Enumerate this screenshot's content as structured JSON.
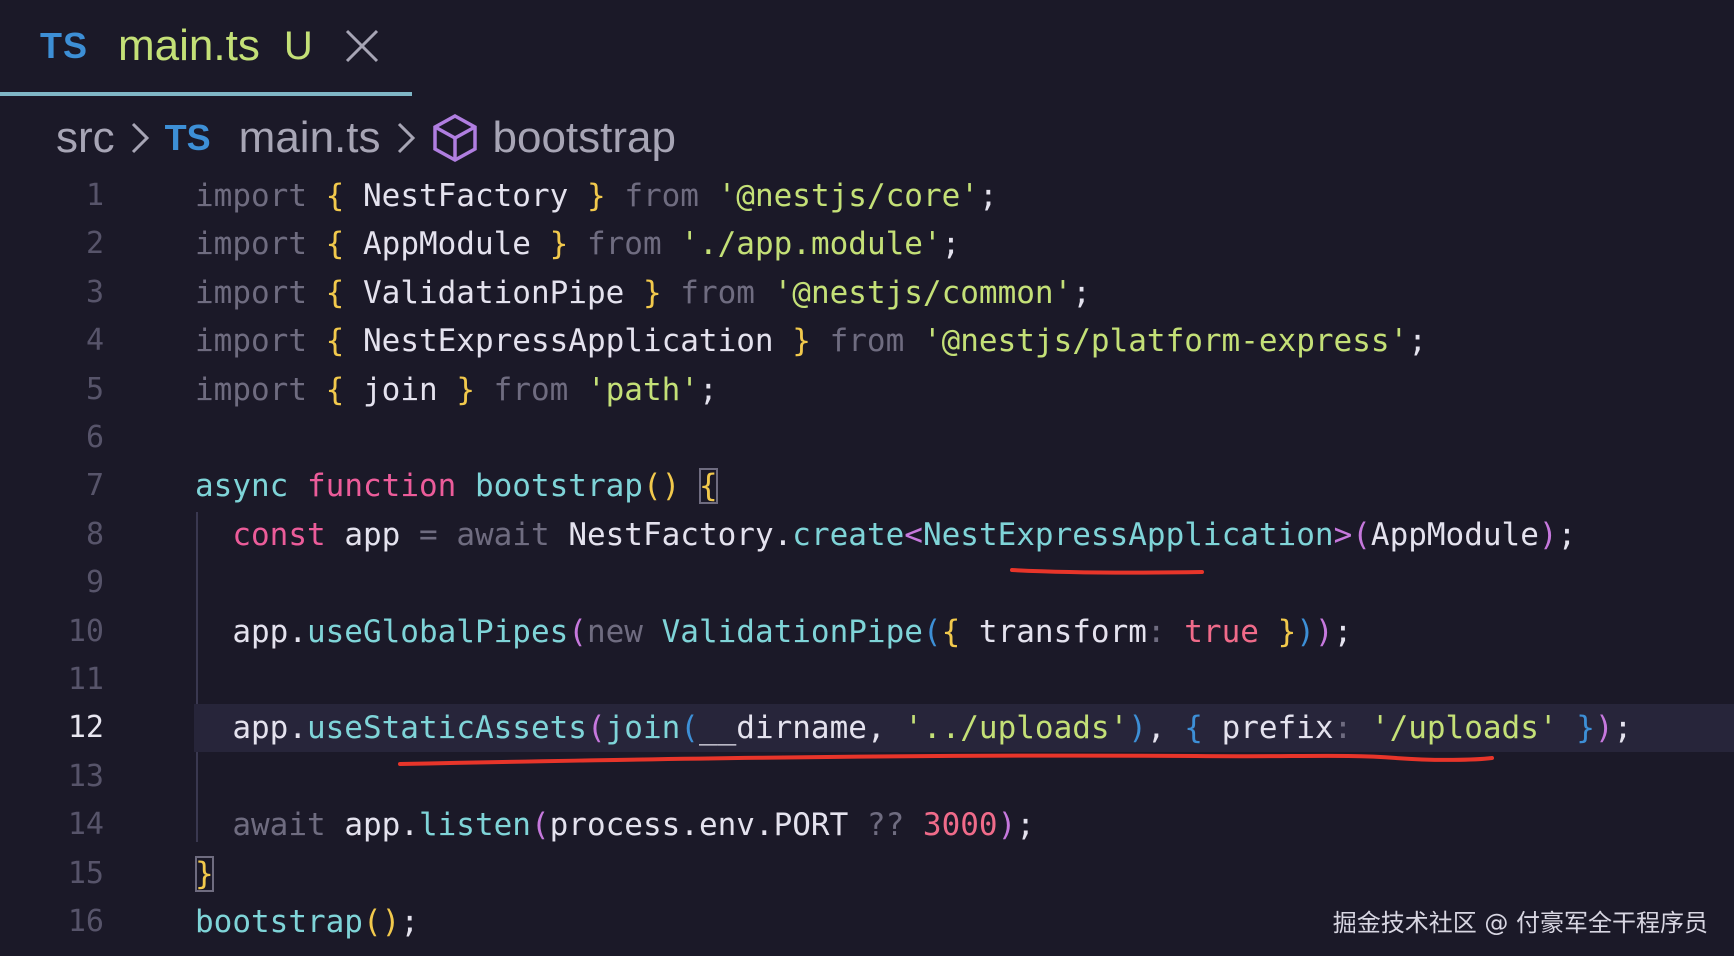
{
  "tab": {
    "lang_badge": "TS",
    "filename": "main.ts",
    "status": "U"
  },
  "breadcrumb": {
    "folder": "src",
    "lang_badge": "TS",
    "file": "main.ts",
    "symbol": "bootstrap"
  },
  "watermark": "掘金技术社区 @ 付豪军全干程序员",
  "colors": {
    "background": "#1b1928",
    "string": "#c4e077",
    "keyword": "#ec5c9a",
    "function": "#7fd4d8",
    "annotation_underline": "#e8352a"
  },
  "editor": {
    "active_line": 12,
    "lines": [
      {
        "n": "1",
        "tokens": [
          [
            "import",
            "kw-dim"
          ],
          [
            " ",
            ""
          ],
          [
            "{",
            "punct-y"
          ],
          [
            " NestFactory ",
            "plain"
          ],
          [
            "}",
            "punct-y"
          ],
          [
            " ",
            ""
          ],
          [
            "from",
            "kw-dim"
          ],
          [
            " ",
            ""
          ],
          [
            "'@nestjs/core'",
            "str"
          ],
          [
            ";",
            "plain"
          ]
        ]
      },
      {
        "n": "2",
        "tokens": [
          [
            "import",
            "kw-dim"
          ],
          [
            " ",
            ""
          ],
          [
            "{",
            "punct-y"
          ],
          [
            " AppModule ",
            "plain"
          ],
          [
            "}",
            "punct-y"
          ],
          [
            " ",
            ""
          ],
          [
            "from",
            "kw-dim"
          ],
          [
            " ",
            ""
          ],
          [
            "'./app.module'",
            "str"
          ],
          [
            ";",
            "plain"
          ]
        ]
      },
      {
        "n": "3",
        "tokens": [
          [
            "import",
            "kw-dim"
          ],
          [
            " ",
            ""
          ],
          [
            "{",
            "punct-y"
          ],
          [
            " ValidationPipe ",
            "plain"
          ],
          [
            "}",
            "punct-y"
          ],
          [
            " ",
            ""
          ],
          [
            "from",
            "kw-dim"
          ],
          [
            " ",
            ""
          ],
          [
            "'@nestjs/common'",
            "str"
          ],
          [
            ";",
            "plain"
          ]
        ]
      },
      {
        "n": "4",
        "tokens": [
          [
            "import",
            "kw-dim"
          ],
          [
            " ",
            ""
          ],
          [
            "{",
            "punct-y"
          ],
          [
            " NestExpressApplication ",
            "plain"
          ],
          [
            "}",
            "punct-y"
          ],
          [
            " ",
            ""
          ],
          [
            "from",
            "kw-dim"
          ],
          [
            " ",
            ""
          ],
          [
            "'@nestjs/platform-express'",
            "str"
          ],
          [
            ";",
            "plain"
          ]
        ]
      },
      {
        "n": "5",
        "tokens": [
          [
            "import",
            "kw-dim"
          ],
          [
            " ",
            ""
          ],
          [
            "{",
            "punct-y"
          ],
          [
            " join ",
            "plain"
          ],
          [
            "}",
            "punct-y"
          ],
          [
            " ",
            ""
          ],
          [
            "from",
            "kw-dim"
          ],
          [
            " ",
            ""
          ],
          [
            "'path'",
            "str"
          ],
          [
            ";",
            "plain"
          ]
        ]
      },
      {
        "n": "6",
        "tokens": []
      },
      {
        "n": "7",
        "tokens": [
          [
            "async",
            "fn"
          ],
          [
            " ",
            ""
          ],
          [
            "function",
            "kw-p"
          ],
          [
            " ",
            ""
          ],
          [
            "bootstrap",
            "fn"
          ],
          [
            "()",
            "punct-y"
          ],
          [
            " ",
            ""
          ],
          [
            "{",
            "punct-y bracket-box"
          ]
        ]
      },
      {
        "n": "8",
        "tokens": [
          [
            "  ",
            ""
          ],
          [
            "const",
            "kw-p"
          ],
          [
            " app ",
            "plain"
          ],
          [
            "=",
            "op"
          ],
          [
            " ",
            ""
          ],
          [
            "await",
            "kw-dim"
          ],
          [
            " NestFactory.",
            "plain"
          ],
          [
            "create",
            "fn"
          ],
          [
            "<",
            "paren-p"
          ],
          [
            "NestExpressApplication",
            "type"
          ],
          [
            ">",
            "paren-p"
          ],
          [
            "(",
            "paren-p"
          ],
          [
            "AppModule",
            "plain"
          ],
          [
            ")",
            "paren-p"
          ],
          [
            ";",
            "plain"
          ]
        ]
      },
      {
        "n": "9",
        "tokens": []
      },
      {
        "n": "10",
        "tokens": [
          [
            "  app.",
            "plain"
          ],
          [
            "useGlobalPipes",
            "fn"
          ],
          [
            "(",
            "paren-p"
          ],
          [
            "new",
            "kw-dim"
          ],
          [
            " ",
            ""
          ],
          [
            "ValidationPipe",
            "type"
          ],
          [
            "(",
            "paren-b"
          ],
          [
            "{",
            "punct-y"
          ],
          [
            " transform",
            "plain"
          ],
          [
            ":",
            "op"
          ],
          [
            " ",
            ""
          ],
          [
            "true",
            "bool"
          ],
          [
            " ",
            ""
          ],
          [
            "}",
            "punct-y"
          ],
          [
            ")",
            "paren-b"
          ],
          [
            ")",
            "paren-p"
          ],
          [
            ";",
            "plain"
          ]
        ]
      },
      {
        "n": "11",
        "tokens": []
      },
      {
        "n": "12",
        "tokens": [
          [
            "  app.",
            "plain"
          ],
          [
            "useStaticAssets",
            "fn"
          ],
          [
            "(",
            "paren-p"
          ],
          [
            "join",
            "fn"
          ],
          [
            "(",
            "paren-b"
          ],
          [
            "__dirname, ",
            "plain"
          ],
          [
            "'../uploads'",
            "str"
          ],
          [
            ")",
            "paren-b"
          ],
          [
            ", ",
            "plain"
          ],
          [
            "{",
            "paren-b"
          ],
          [
            " prefix",
            "plain"
          ],
          [
            ":",
            "op"
          ],
          [
            " ",
            ""
          ],
          [
            "'/uploads'",
            "str"
          ],
          [
            " ",
            ""
          ],
          [
            "}",
            "paren-b"
          ],
          [
            ")",
            "paren-p"
          ],
          [
            ";",
            "plain"
          ]
        ]
      },
      {
        "n": "13",
        "tokens": []
      },
      {
        "n": "14",
        "tokens": [
          [
            "  ",
            ""
          ],
          [
            "await",
            "kw-dim"
          ],
          [
            " app.",
            "plain"
          ],
          [
            "listen",
            "fn"
          ],
          [
            "(",
            "paren-p"
          ],
          [
            "process.env.PORT ",
            "plain"
          ],
          [
            "??",
            "op"
          ],
          [
            " ",
            ""
          ],
          [
            "3000",
            "num"
          ],
          [
            ")",
            "paren-p"
          ],
          [
            ";",
            "plain"
          ]
        ]
      },
      {
        "n": "15",
        "tokens": [
          [
            "}",
            "punct-y bracket-box"
          ]
        ]
      },
      {
        "n": "16",
        "tokens": [
          [
            "bootstrap",
            "fn"
          ],
          [
            "()",
            "punct-y"
          ],
          [
            ";",
            "plain"
          ]
        ]
      }
    ]
  }
}
